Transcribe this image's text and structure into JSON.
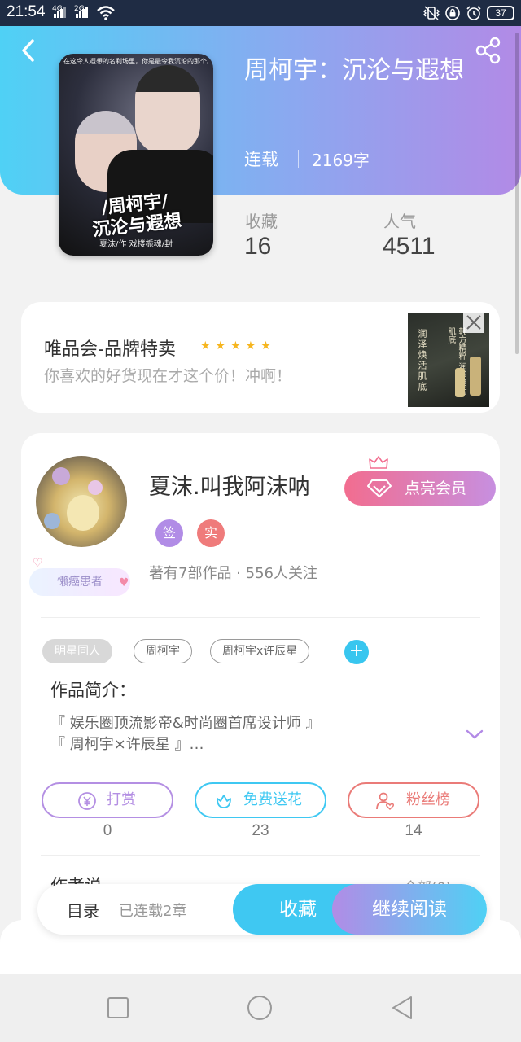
{
  "status_bar": {
    "time": "21:54",
    "net1": "4G",
    "net2": "2G",
    "battery": "37"
  },
  "book": {
    "title": "周柯宇：沉沦与遐想",
    "status": "连载",
    "word_count": "2169字",
    "favorites_label": "收藏",
    "favorites_value": "16",
    "popularity_label": "人气",
    "popularity_value": "4511",
    "cover": {
      "top_text": "在这令人遐想的名利场里，你是最令我沉沦的那个。",
      "title": "/周柯宇/\n沉沦与遐想",
      "author_line": "夏沫/作 戏楼栀魂/封"
    }
  },
  "ad": {
    "title": "唯品会-品牌特卖",
    "stars": "★★★★★",
    "subtitle": "你喜欢的好货现在才这个价！冲啊！",
    "image_text_1": "润泽焕活肌底",
    "image_text_2": "韩方精粹 润泽焕活肌底"
  },
  "author": {
    "name": "夏沫.叫我阿沫呐",
    "badge": "懒癌患者",
    "vip_button": "点亮会员",
    "tag_sign": "签",
    "tag_real": "实",
    "meta": "著有7部作品 · 556人关注"
  },
  "tags": [
    "明星同人",
    "周柯宇",
    "周柯宇x许辰星",
    "+"
  ],
  "intro": {
    "label": "作品简介：",
    "lines": [
      "『 娱乐圈顶流影帝&时尚圈首席设计师 』",
      "『 周柯宇×许辰星 』…"
    ]
  },
  "actions": [
    {
      "label": "打赏",
      "count": "0",
      "color": "#b48fe3"
    },
    {
      "label": "免费送花",
      "count": "23",
      "color": "#3fc8f2"
    },
    {
      "label": "粉丝榜",
      "count": "14",
      "color": "#ea7b78"
    }
  ],
  "author_says": {
    "label": "作者说",
    "all": "全部(0) >"
  },
  "bottom_bar": {
    "toc": "目录",
    "toc_sub": "已连载2章",
    "collect": "收藏",
    "read": "继续阅读"
  },
  "colors": {
    "accent_cyan": "#3fc8f2",
    "accent_purple": "#b28ae6",
    "vip_pink": "#f26d8f"
  }
}
